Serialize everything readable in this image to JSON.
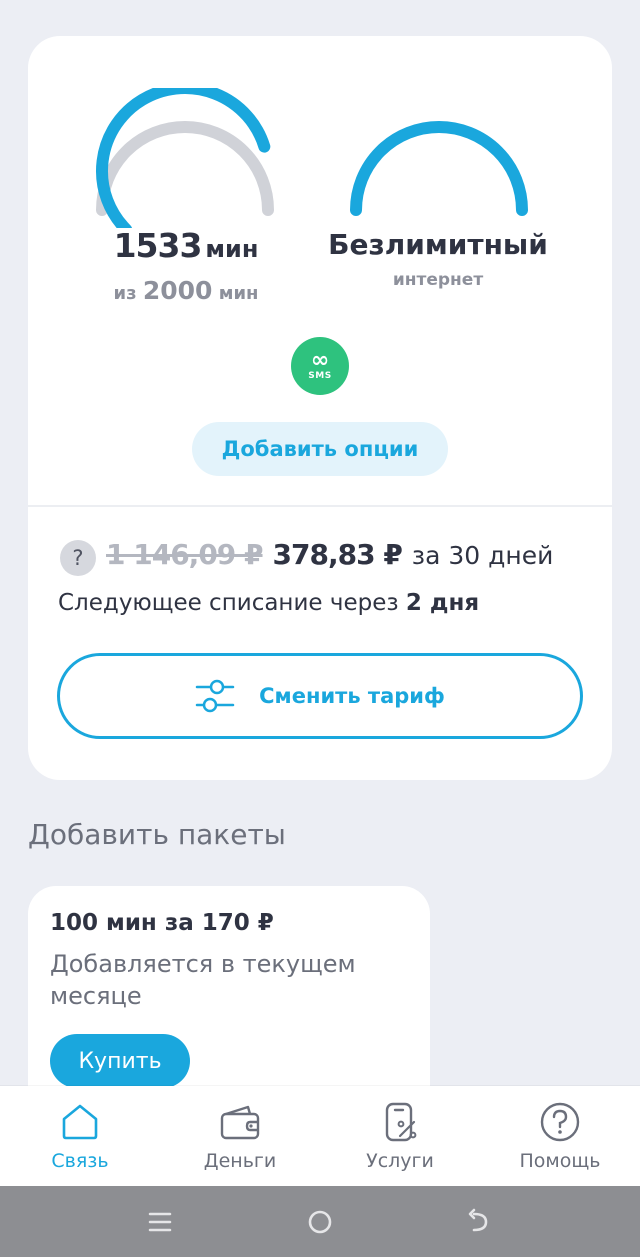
{
  "usage": {
    "minutes_used": "1533",
    "minutes_unit": "мин",
    "minutes_total_prefix": "из",
    "minutes_total": "2000",
    "minutes_total_unit": "мин",
    "minutes_fraction": 0.77,
    "internet_title": "Безлимитный",
    "internet_sub": "интернет",
    "sms_badge": "SMS",
    "sms_symbol": "∞",
    "add_options_label": "Добавить опции"
  },
  "billing": {
    "help_icon": "?",
    "old_price": "1 146,09 ₽",
    "new_price": "378,83 ₽",
    "period": "за 30 дней",
    "next_charge_prefix": "Следующее списание через",
    "next_charge_when": "2 дня",
    "change_plan_label": "Сменить тариф"
  },
  "packages": {
    "section_title": "Добавить пакеты",
    "items": [
      {
        "title": "100 мин за 170 ₽",
        "description": "Добавляется в текущем месяце",
        "buy_label": "Купить"
      }
    ]
  },
  "tabbar": {
    "items": [
      {
        "label": "Связь",
        "icon": "home-icon",
        "active": true
      },
      {
        "label": "Деньги",
        "icon": "wallet-icon",
        "active": false
      },
      {
        "label": "Услуги",
        "icon": "services-icon",
        "active": false
      },
      {
        "label": "Помощь",
        "icon": "help-icon",
        "active": false
      }
    ]
  },
  "system_nav": {
    "icons": [
      "menu-icon",
      "home-circle-icon",
      "back-icon"
    ]
  },
  "colors": {
    "accent": "#1aa7dd",
    "gauge_track": "#d0d2d8",
    "sms_green": "#2ec27e",
    "background": "#eceef4"
  }
}
